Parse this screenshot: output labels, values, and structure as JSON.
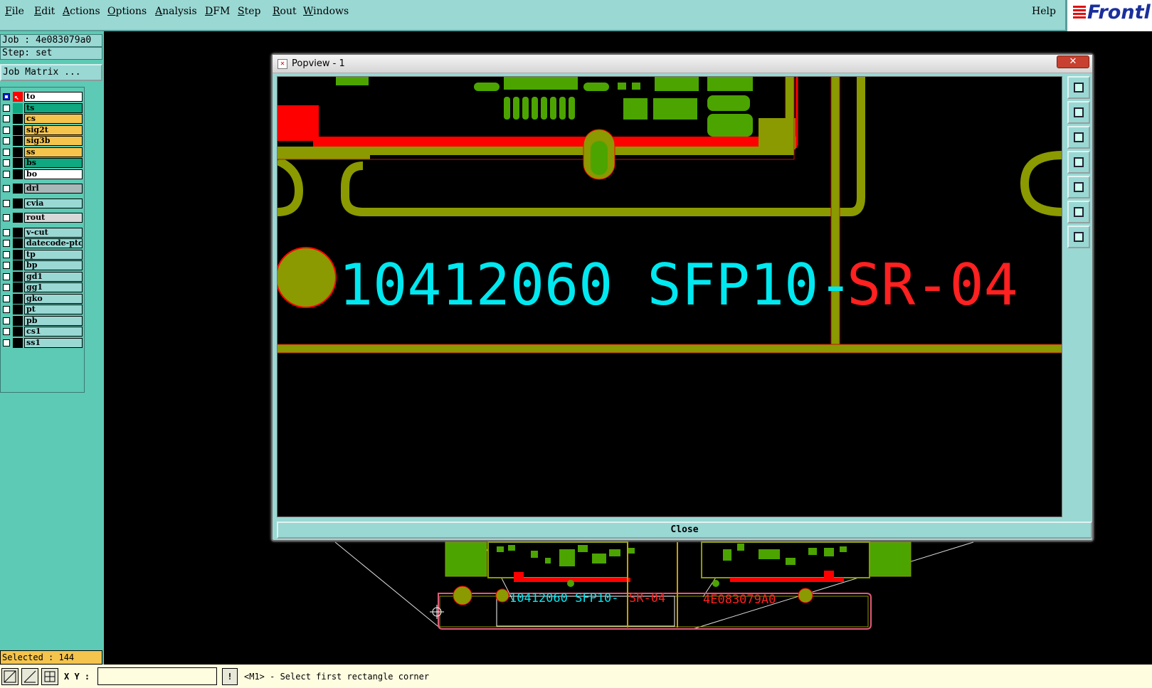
{
  "menubar": {
    "items": [
      {
        "label": "File",
        "u": "F",
        "rest": "ile"
      },
      {
        "label": "Edit",
        "u": "E",
        "rest": "dit"
      },
      {
        "label": "Actions",
        "u": "A",
        "rest": "ctions"
      },
      {
        "label": "Options",
        "u": "O",
        "rest": "ptions"
      },
      {
        "label": "Analysis",
        "u": "A",
        "rest": "nalysis"
      },
      {
        "label": "DFM",
        "u": "D",
        "rest": "FM"
      },
      {
        "label": "Step",
        "u": "S",
        "rest": "tep"
      },
      {
        "label": "Rout",
        "u": "R",
        "rest": "out"
      },
      {
        "label": "Windows",
        "u": "W",
        "rest": "indows"
      }
    ],
    "help": "Help",
    "logo": "Frontl"
  },
  "left": {
    "job": "Job : 4e083079a0",
    "step": "Step: set",
    "job_matrix": "Job Matrix ...",
    "layers": [
      {
        "name": "to",
        "color": "#ffffff",
        "swatch": "#ff0000",
        "active": true
      },
      {
        "name": "ts",
        "color": "#10a880",
        "swatch": "#10a880"
      },
      {
        "name": "cs",
        "color": "#f5c44c",
        "swatch": "#000000"
      },
      {
        "name": "sig2t",
        "color": "#f5c44c",
        "swatch": "#000000"
      },
      {
        "name": "sig3b",
        "color": "#f5c44c",
        "swatch": "#000000"
      },
      {
        "name": "ss",
        "color": "#f5c44c",
        "swatch": "#000000"
      },
      {
        "name": "bs",
        "color": "#10a880",
        "swatch": "#000000"
      },
      {
        "name": "bo",
        "color": "#ffffff",
        "swatch": "#000000"
      },
      {
        "name": "drl",
        "color": "#a8b8b8",
        "swatch": "#000000",
        "gap": true
      },
      {
        "name": "cvia",
        "color": "#9ad8d4",
        "swatch": "#000000",
        "gap": true
      },
      {
        "name": "rout",
        "color": "#d8d8d8",
        "swatch": "#000000",
        "gap": true
      },
      {
        "name": "v-cut",
        "color": "#9ad8d4",
        "swatch": "#000000",
        "gap": true
      },
      {
        "name": "datecode-ptc",
        "color": "#9ad8d4",
        "swatch": "#000000"
      },
      {
        "name": "tp",
        "color": "#9ad8d4",
        "swatch": "#000000"
      },
      {
        "name": "bp",
        "color": "#9ad8d4",
        "swatch": "#000000"
      },
      {
        "name": "gd1",
        "color": "#9ad8d4",
        "swatch": "#000000"
      },
      {
        "name": "gg1",
        "color": "#9ad8d4",
        "swatch": "#000000"
      },
      {
        "name": "gko",
        "color": "#9ad8d4",
        "swatch": "#000000"
      },
      {
        "name": "pt",
        "color": "#9ad8d4",
        "swatch": "#000000"
      },
      {
        "name": "pb",
        "color": "#9ad8d4",
        "swatch": "#000000"
      },
      {
        "name": "cs1",
        "color": "#9ad8d4",
        "swatch": "#000000"
      },
      {
        "name": "ss1",
        "color": "#9ad8d4",
        "swatch": "#000000"
      }
    ],
    "selected": "Selected : 144"
  },
  "popview": {
    "title": "Popview - 1",
    "close_x": "✕",
    "close_button": "Close",
    "pcb_text_cyan": "10412060 SFP10-",
    "pcb_text_red": "SR-04"
  },
  "background_board": {
    "text_cyan": "10412060 SFP10-",
    "text_red": "SR-04",
    "text_red2": "4E083079A0"
  },
  "statusbar": {
    "xy_label": "X Y :",
    "xy_value": "",
    "excl": "!",
    "prompt": "<M1> - Select first rectangle corner"
  },
  "colors": {
    "panel": "#5ccab4",
    "menubar": "#9ad8d4",
    "copper": "#8a9a00",
    "mask": "#4ca400",
    "trace": "#ff0000",
    "text_cyan": "#00e8f0"
  }
}
